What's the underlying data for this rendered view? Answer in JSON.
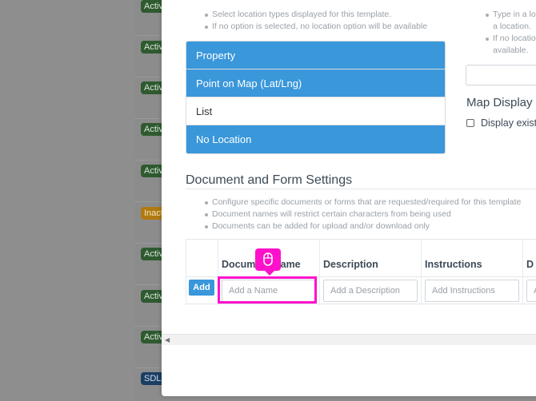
{
  "background": {
    "badges": [
      {
        "label": "Active",
        "variant": "active"
      },
      {
        "label": "Active",
        "variant": "active"
      },
      {
        "label": "Active",
        "variant": "active"
      },
      {
        "label": "Active",
        "variant": "active"
      },
      {
        "label": "Active",
        "variant": "active"
      },
      {
        "label": "Inactive",
        "variant": "inactive"
      },
      {
        "label": "Active",
        "variant": "active"
      },
      {
        "label": "Active",
        "variant": "active"
      },
      {
        "label": "Active",
        "variant": "active"
      },
      {
        "label": "SDL",
        "variant": "sdl"
      }
    ]
  },
  "location": {
    "hints": [
      "Select location types displayed for this template.",
      "If no option is selected, no location option will be available"
    ],
    "options": [
      {
        "label": "Property",
        "selected": true
      },
      {
        "label": "Point on Map (Lat/Lng)",
        "selected": true
      },
      {
        "label": "List",
        "selected": false
      },
      {
        "label": "No Location",
        "selected": true
      }
    ]
  },
  "right_panel": {
    "hint1_line1": "Type in a lo",
    "hint1_line2": "a location.",
    "hint2_line1": "If no locatio",
    "hint2_line2": "available.",
    "map_display_title": "Map Display",
    "display_checkbox_label": "Display exist"
  },
  "documents": {
    "title": "Document and Form Settings",
    "hints": [
      "Configure specific documents or forms that are requested/required for this template",
      "Document names will restrict certain characters from being used",
      "Documents can be added for upload and/or download only"
    ],
    "columns": {
      "name": "Document Name",
      "description": "Description",
      "instructions": "Instructions",
      "extra": "D"
    },
    "add_button": "Add",
    "placeholders": {
      "name": "Add a Name",
      "description": "Add a Description",
      "instructions": "Add Instructions",
      "extra": "A"
    }
  },
  "colors": {
    "accent": "#3a97da",
    "highlight": "#ff11cc",
    "active_badge": "#2f5a30",
    "inactive_badge": "#b07a10",
    "sdl_badge": "#1c3e63"
  },
  "icons": {
    "cursor": "mouse-icon",
    "scroll_left": "scroll-left-arrow-icon"
  }
}
